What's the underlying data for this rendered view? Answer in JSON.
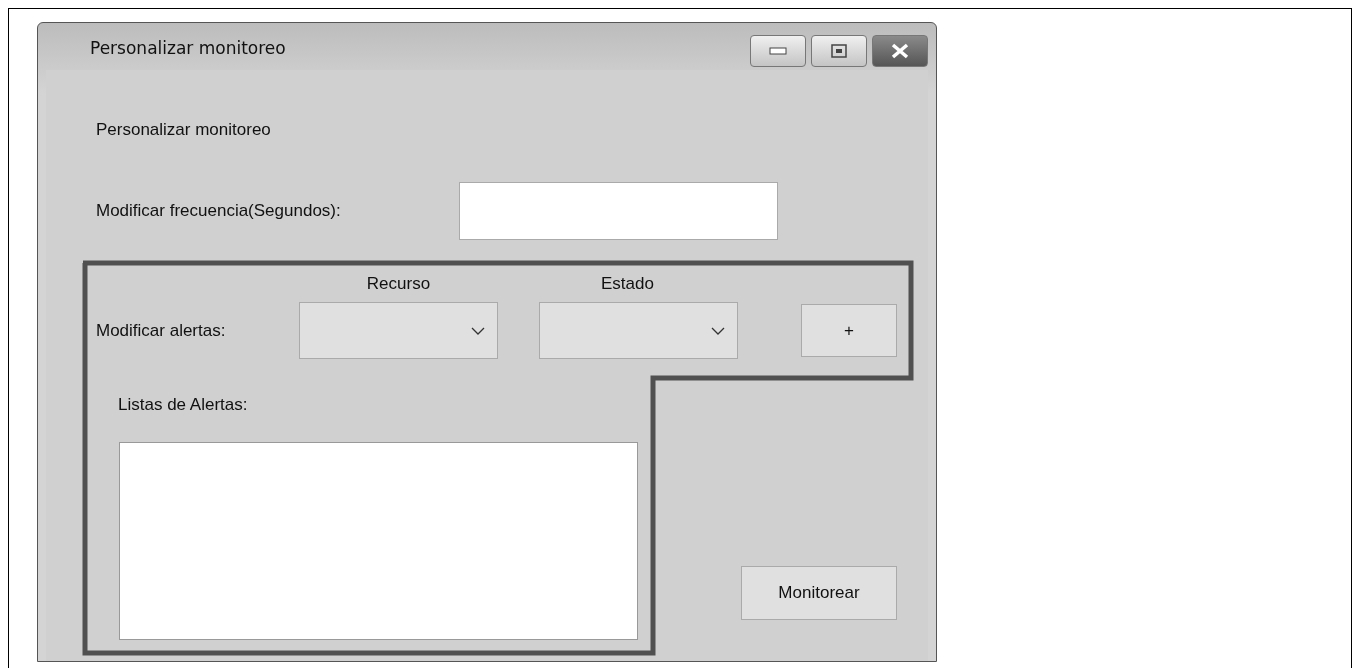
{
  "window": {
    "title": "Personalizar monitoreo"
  },
  "heading": "Personalizar monitoreo",
  "frequency": {
    "label": "Modificar frecuencia(Segundos):"
  },
  "alerts": {
    "label": "Modificar alertas:",
    "dropdowns": [
      {
        "label": "Recurso"
      },
      {
        "label": "Estado"
      }
    ],
    "add_button": "+"
  },
  "alert_list": {
    "label": "Listas de Alertas:"
  },
  "monitor_button": "Monitorear"
}
